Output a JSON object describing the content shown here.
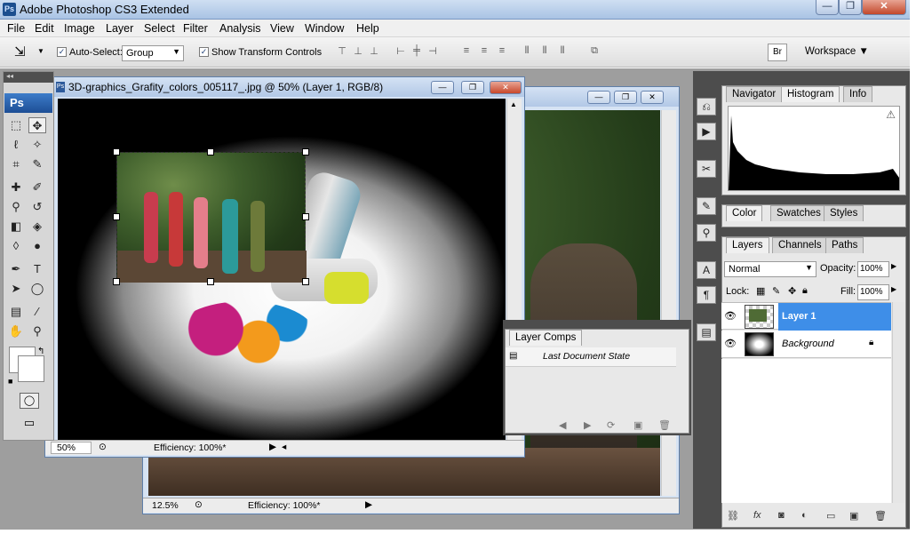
{
  "app": {
    "title": "Adobe Photoshop CS3 Extended",
    "logo": "Ps"
  },
  "window_controls": {
    "minimize": "—",
    "maximize": "❐",
    "close": "✕"
  },
  "menu": [
    "File",
    "Edit",
    "Image",
    "Layer",
    "Select",
    "Filter",
    "Analysis",
    "View",
    "Window",
    "Help"
  ],
  "options": {
    "auto_select_label": "Auto-Select:",
    "auto_select_checked": true,
    "auto_select_value": "Group",
    "show_transform_label": "Show Transform Controls",
    "show_transform_checked": true,
    "workspace_label": "Workspace ▼"
  },
  "toolbox": {
    "logo": "Ps",
    "tools": [
      {
        "name": "marquee-tool-icon",
        "glyph": "⬚"
      },
      {
        "name": "move-tool-icon",
        "glyph": "✥",
        "selected": true
      },
      {
        "name": "lasso-tool-icon",
        "glyph": "ℓ"
      },
      {
        "name": "magic-wand-tool-icon",
        "glyph": "✧"
      },
      {
        "name": "crop-tool-icon",
        "glyph": "⌗"
      },
      {
        "name": "eyedropper-tool-icon",
        "glyph": "✎"
      },
      {
        "name": "healing-brush-tool-icon",
        "glyph": "✚"
      },
      {
        "name": "brush-tool-icon",
        "glyph": "✐"
      },
      {
        "name": "clone-stamp-tool-icon",
        "glyph": "⚲"
      },
      {
        "name": "history-brush-tool-icon",
        "glyph": "↺"
      },
      {
        "name": "eraser-tool-icon",
        "glyph": "◧"
      },
      {
        "name": "paint-bucket-tool-icon",
        "glyph": "◈"
      },
      {
        "name": "blur-tool-icon",
        "glyph": "◊"
      },
      {
        "name": "dodge-tool-icon",
        "glyph": "●"
      },
      {
        "name": "pen-tool-icon",
        "glyph": "✒"
      },
      {
        "name": "type-tool-icon",
        "glyph": "T"
      },
      {
        "name": "path-selection-tool-icon",
        "glyph": "➤"
      },
      {
        "name": "ellipse-tool-icon",
        "glyph": "◯"
      },
      {
        "name": "notes-tool-icon",
        "glyph": "▤"
      },
      {
        "name": "eyedropper2-tool-icon",
        "glyph": "⁄"
      },
      {
        "name": "hand-tool-icon",
        "glyph": "✋"
      },
      {
        "name": "zoom-tool-icon",
        "glyph": "⚲"
      }
    ]
  },
  "doc_front": {
    "title": "3D-graphics_Grafity_colors_005117_.jpg @ 50% (Layer 1, RGB/8)",
    "zoom": "50%",
    "efficiency": "Efficiency: 100%*"
  },
  "doc_back": {
    "zoom": "12.5%",
    "efficiency": "Efficiency: 100%*"
  },
  "panels": {
    "navigator_tabs": [
      "Navigator",
      "Histogram",
      "Info"
    ],
    "color_tabs": [
      "Color",
      "Swatches",
      "Styles"
    ],
    "layers_tabs": [
      "Layers",
      "Channels",
      "Paths"
    ],
    "blend_mode": "Normal",
    "opacity_label": "Opacity:",
    "opacity_value": "100%",
    "lock_label": "Lock:",
    "fill_label": "Fill:",
    "fill_value": "100%",
    "layers": [
      {
        "name": "Layer 1",
        "selected": true
      },
      {
        "name": "Background",
        "selected": false
      }
    ],
    "layer_comps_tab": "Layer Comps",
    "layer_comps_state": "Last Document State"
  }
}
